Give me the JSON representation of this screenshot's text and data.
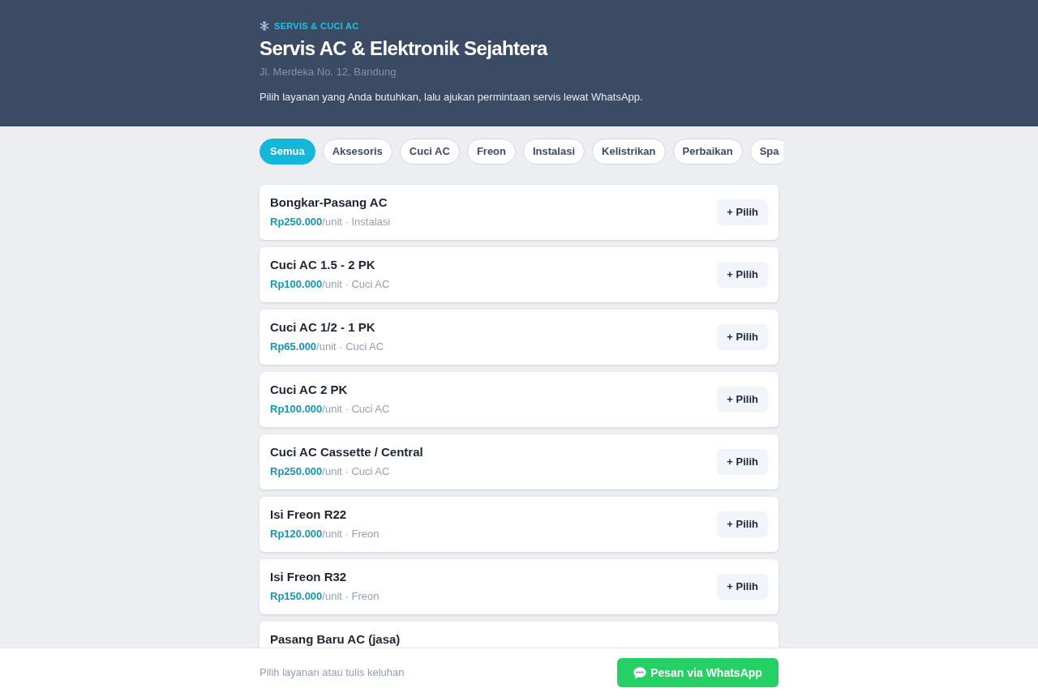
{
  "header": {
    "category": "SERVIS & CUCI AC",
    "title": "Servis AC & Elektronik Sejahtera",
    "address": "Jl. Merdeka No. 12, Bandung",
    "description": "Pilih layanan yang Anda butuhkan, lalu ajukan permintaan servis lewat WhatsApp."
  },
  "filters": [
    {
      "label": "Semua",
      "selected": true
    },
    {
      "label": "Aksesoris",
      "selected": false
    },
    {
      "label": "Cuci AC",
      "selected": false
    },
    {
      "label": "Freon",
      "selected": false
    },
    {
      "label": "Instalasi",
      "selected": false
    },
    {
      "label": "Kelistrikan",
      "selected": false
    },
    {
      "label": "Perbaikan",
      "selected": false
    },
    {
      "label": "Spa",
      "selected": false
    }
  ],
  "services": [
    {
      "name": "Bongkar-Pasang AC",
      "price": "Rp250.000",
      "detail": "/unit · Instalasi",
      "button": "+ Pilih"
    },
    {
      "name": "Cuci AC 1.5 - 2 PK",
      "price": "Rp100.000",
      "detail": "/unit · Cuci AC",
      "button": "+ Pilih"
    },
    {
      "name": "Cuci AC 1/2 - 1 PK",
      "price": "Rp65.000",
      "detail": "/unit · Cuci AC",
      "button": "+ Pilih"
    },
    {
      "name": "Cuci AC 2 PK",
      "price": "Rp100.000",
      "detail": "/unit · Cuci AC",
      "button": "+ Pilih"
    },
    {
      "name": "Cuci AC Cassette / Central",
      "price": "Rp250.000",
      "detail": "/unit · Cuci AC",
      "button": "+ Pilih"
    },
    {
      "name": "Isi Freon R22",
      "price": "Rp120.000",
      "detail": "/unit · Freon",
      "button": "+ Pilih"
    },
    {
      "name": "Isi Freon R32",
      "price": "Rp150.000",
      "detail": "/unit · Freon",
      "button": "+ Pilih"
    },
    {
      "name": "Pasang Baru AC (jasa)"
    }
  ],
  "footer": {
    "hint": "Pilih layanan atau tulis keluhan",
    "button": "Pesan via WhatsApp"
  }
}
